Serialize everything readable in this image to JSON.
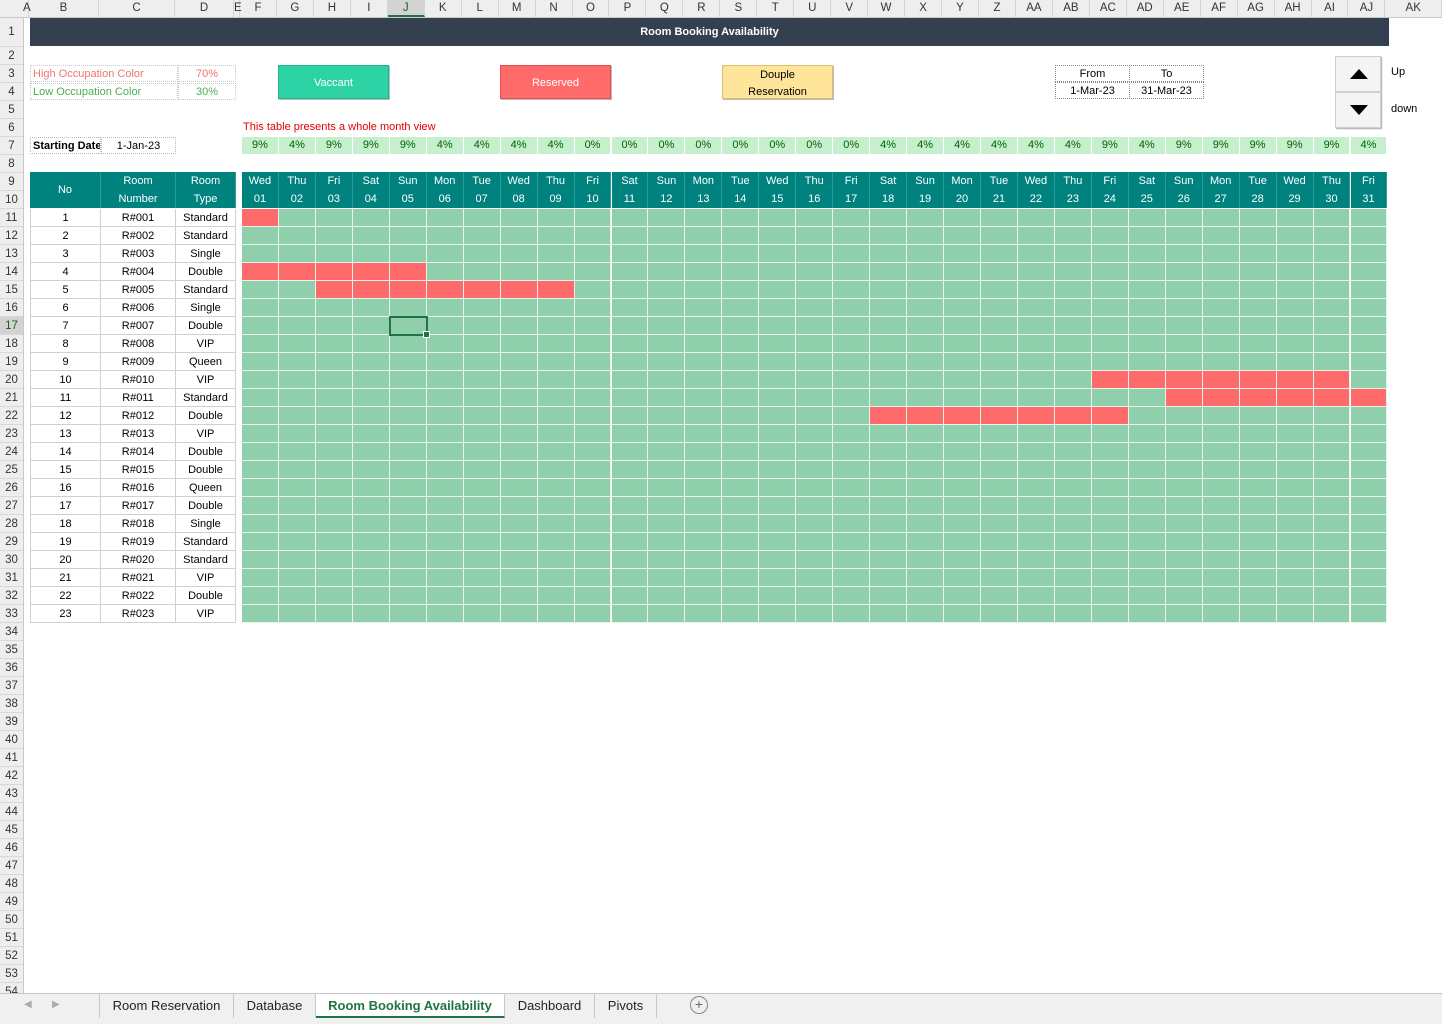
{
  "title": "Room Booking Availability",
  "columns": [
    "A",
    "B",
    "C",
    "D",
    "E",
    "F",
    "G",
    "H",
    "I",
    "J",
    "K",
    "L",
    "M",
    "N",
    "O",
    "P",
    "Q",
    "R",
    "S",
    "T",
    "U",
    "V",
    "W",
    "X",
    "Y",
    "Z",
    "AA",
    "AB",
    "AC",
    "AD",
    "AE",
    "AF",
    "AG",
    "AH",
    "AI",
    "AJ",
    "AK"
  ],
  "selected_column": "J",
  "selected_row": "17",
  "legend": {
    "high_label": "High Occupation Color",
    "high_value": "70%",
    "low_label": "Low Occupation Color",
    "low_value": "30%",
    "high_color": "#f07474",
    "low_color": "#4caf50"
  },
  "buttons": {
    "vacant": "Vaccant",
    "reserved": "Reserved",
    "double_line1": "Douple",
    "double_line2": "Reservation"
  },
  "range": {
    "from_label": "From",
    "to_label": "To",
    "from_value": "1-Mar-23",
    "to_value": "31-Mar-23"
  },
  "spin": {
    "up_label": "Up",
    "down_label": "down"
  },
  "note": "This table presents a whole month view",
  "starting_date_label": "Starting Date",
  "starting_date_value": "1-Jan-23",
  "occupancy": [
    "9%",
    "4%",
    "9%",
    "9%",
    "9%",
    "4%",
    "4%",
    "4%",
    "4%",
    "0%",
    "0%",
    "0%",
    "0%",
    "0%",
    "0%",
    "0%",
    "0%",
    "4%",
    "4%",
    "4%",
    "4%",
    "4%",
    "4%",
    "9%",
    "4%",
    "9%",
    "9%",
    "9%",
    "9%",
    "9%",
    "4%"
  ],
  "headers": {
    "no": "No",
    "room_number_1": "Room",
    "room_number_2": "Number",
    "room_type_1": "Room",
    "room_type_2": "Type"
  },
  "days": [
    {
      "dow": "Wed",
      "d": "01"
    },
    {
      "dow": "Thu",
      "d": "02"
    },
    {
      "dow": "Fri",
      "d": "03"
    },
    {
      "dow": "Sat",
      "d": "04"
    },
    {
      "dow": "Sun",
      "d": "05"
    },
    {
      "dow": "Mon",
      "d": "06"
    },
    {
      "dow": "Tue",
      "d": "07"
    },
    {
      "dow": "Wed",
      "d": "08"
    },
    {
      "dow": "Thu",
      "d": "09"
    },
    {
      "dow": "Fri",
      "d": "10"
    },
    {
      "dow": "Sat",
      "d": "11"
    },
    {
      "dow": "Sun",
      "d": "12"
    },
    {
      "dow": "Mon",
      "d": "13"
    },
    {
      "dow": "Tue",
      "d": "14"
    },
    {
      "dow": "Wed",
      "d": "15"
    },
    {
      "dow": "Thu",
      "d": "16"
    },
    {
      "dow": "Fri",
      "d": "17"
    },
    {
      "dow": "Sat",
      "d": "18"
    },
    {
      "dow": "Sun",
      "d": "19"
    },
    {
      "dow": "Mon",
      "d": "20"
    },
    {
      "dow": "Tue",
      "d": "21"
    },
    {
      "dow": "Wed",
      "d": "22"
    },
    {
      "dow": "Thu",
      "d": "23"
    },
    {
      "dow": "Fri",
      "d": "24"
    },
    {
      "dow": "Sat",
      "d": "25"
    },
    {
      "dow": "Sun",
      "d": "26"
    },
    {
      "dow": "Mon",
      "d": "27"
    },
    {
      "dow": "Tue",
      "d": "28"
    },
    {
      "dow": "Wed",
      "d": "29"
    },
    {
      "dow": "Thu",
      "d": "30"
    },
    {
      "dow": "Fri",
      "d": "31"
    }
  ],
  "rooms": [
    {
      "no": "1",
      "num": "R#001",
      "type": "Standard",
      "reserved": [
        [
          1,
          1
        ]
      ]
    },
    {
      "no": "2",
      "num": "R#002",
      "type": "Standard",
      "reserved": []
    },
    {
      "no": "3",
      "num": "R#003",
      "type": "Single",
      "reserved": []
    },
    {
      "no": "4",
      "num": "R#004",
      "type": "Double",
      "reserved": [
        [
          1,
          5
        ]
      ]
    },
    {
      "no": "5",
      "num": "R#005",
      "type": "Standard",
      "reserved": [
        [
          3,
          9
        ]
      ]
    },
    {
      "no": "6",
      "num": "R#006",
      "type": "Single",
      "reserved": []
    },
    {
      "no": "7",
      "num": "R#007",
      "type": "Double",
      "reserved": []
    },
    {
      "no": "8",
      "num": "R#008",
      "type": "VIP",
      "reserved": []
    },
    {
      "no": "9",
      "num": "R#009",
      "type": "Queen",
      "reserved": []
    },
    {
      "no": "10",
      "num": "R#010",
      "type": "VIP",
      "reserved": [
        [
          24,
          30
        ]
      ]
    },
    {
      "no": "11",
      "num": "R#011",
      "type": "Standard",
      "reserved": [
        [
          26,
          31
        ]
      ]
    },
    {
      "no": "12",
      "num": "R#012",
      "type": "Double",
      "reserved": [
        [
          18,
          24
        ]
      ]
    },
    {
      "no": "13",
      "num": "R#013",
      "type": "VIP",
      "reserved": []
    },
    {
      "no": "14",
      "num": "R#014",
      "type": "Double",
      "reserved": []
    },
    {
      "no": "15",
      "num": "R#015",
      "type": "Double",
      "reserved": []
    },
    {
      "no": "16",
      "num": "R#016",
      "type": "Queen",
      "reserved": []
    },
    {
      "no": "17",
      "num": "R#017",
      "type": "Double",
      "reserved": []
    },
    {
      "no": "18",
      "num": "R#018",
      "type": "Single",
      "reserved": []
    },
    {
      "no": "19",
      "num": "R#019",
      "type": "Standard",
      "reserved": []
    },
    {
      "no": "20",
      "num": "R#020",
      "type": "Standard",
      "reserved": []
    },
    {
      "no": "21",
      "num": "R#021",
      "type": "VIP",
      "reserved": []
    },
    {
      "no": "22",
      "num": "R#022",
      "type": "Double",
      "reserved": []
    },
    {
      "no": "23",
      "num": "R#023",
      "type": "VIP",
      "reserved": []
    }
  ],
  "colors": {
    "vacant": "#8fcfab",
    "reserved": "#ff6b6b",
    "header": "#00827f",
    "title_bar": "#343f4f",
    "vacant_button": "#2dd3a5",
    "double_button": "#ffe599"
  },
  "tabs": [
    {
      "label": "Room Reservation",
      "active": false
    },
    {
      "label": "Database",
      "active": false
    },
    {
      "label": "Room Booking Availability",
      "active": true
    },
    {
      "label": "Dashboard",
      "active": false
    },
    {
      "label": "Pivots",
      "active": false
    }
  ],
  "add_sheet_icon": "plus-circle-icon"
}
